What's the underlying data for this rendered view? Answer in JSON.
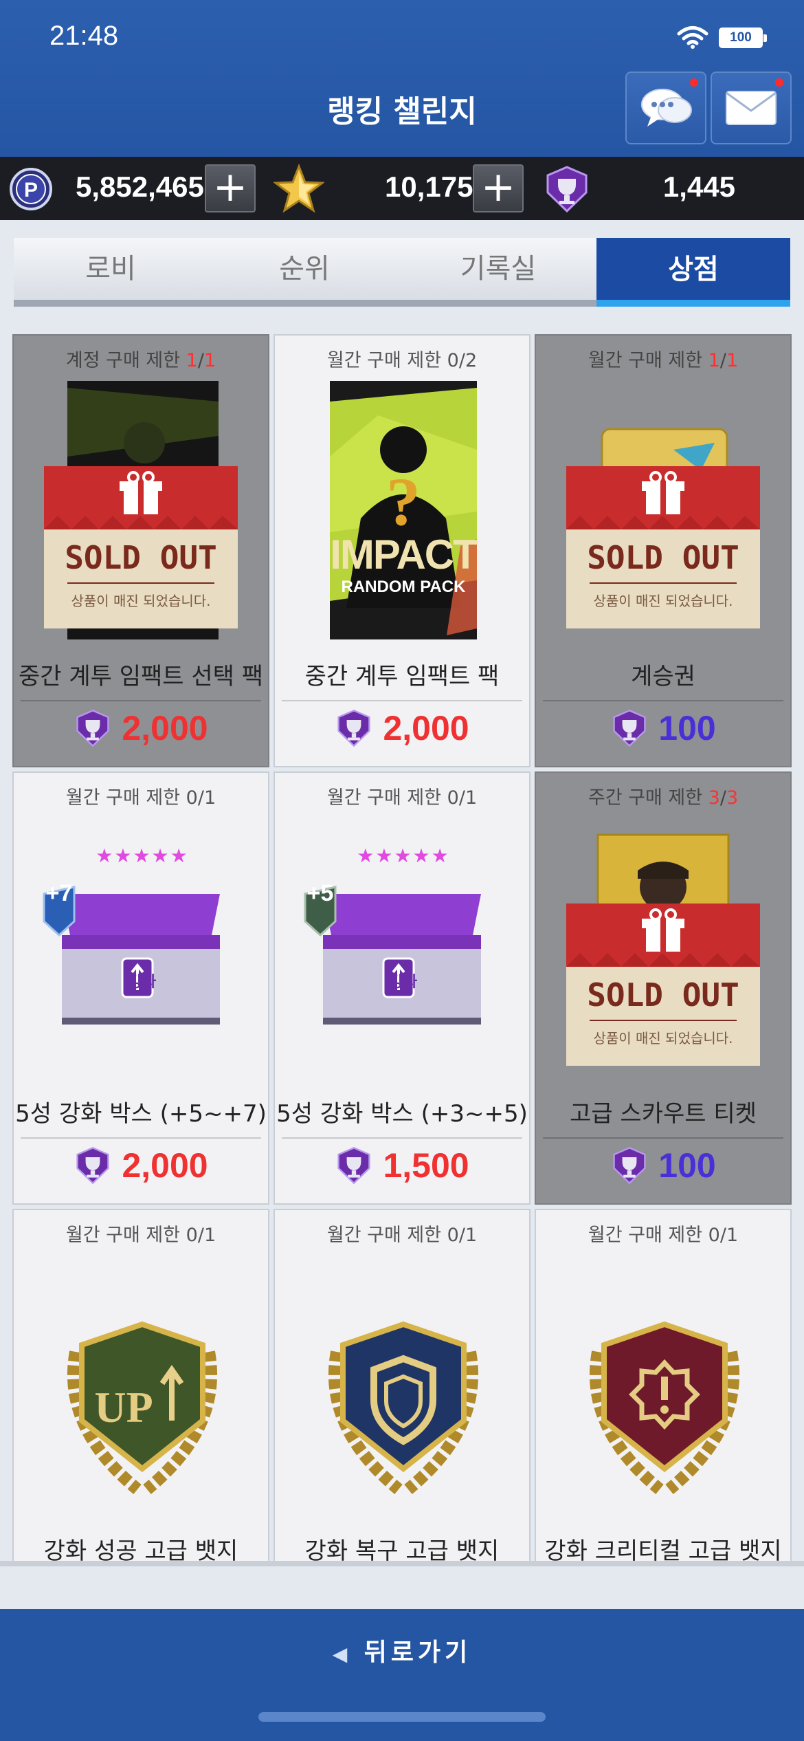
{
  "status_bar": {
    "time": "21:48",
    "battery": "100"
  },
  "header": {
    "title": "랭킹 챌린지",
    "chat_icon": "chat-bubble-icon",
    "mail_icon": "envelope-icon"
  },
  "currency": {
    "points": "5,852,465",
    "stars": "10,175",
    "trophies": "1,445",
    "plus": "+"
  },
  "tabs": [
    {
      "label": "로비",
      "active": false
    },
    {
      "label": "순위",
      "active": false
    },
    {
      "label": "기록실",
      "active": false
    },
    {
      "label": "상점",
      "active": true
    }
  ],
  "items": [
    {
      "limit_prefix": "계정 구매 제한 ",
      "limit_count": "1",
      "limit_sep": "/",
      "limit_total": "1",
      "name": "중간 계투 임팩트 선택 팩",
      "price": "2,000",
      "price_color": "red",
      "sold_out": true
    },
    {
      "limit_prefix": "월간 구매 제한 ",
      "limit_count": "0",
      "limit_sep": "/",
      "limit_total": "2",
      "name": "중간 계투 임팩트 팩",
      "price": "2,000",
      "price_color": "red",
      "sold_out": false
    },
    {
      "limit_prefix": "월간 구매 제한 ",
      "limit_count": "1",
      "limit_sep": "/",
      "limit_total": "1",
      "name": "계승권",
      "price": "100",
      "price_color": "blue",
      "sold_out": true
    },
    {
      "limit_prefix": "월간 구매 제한 ",
      "limit_count": "0",
      "limit_sep": "/",
      "limit_total": "1",
      "name": "5성 강화 박스 (+5~+7)",
      "price": "2,000",
      "price_color": "red",
      "sold_out": false,
      "badge": "+7"
    },
    {
      "limit_prefix": "월간 구매 제한 ",
      "limit_count": "0",
      "limit_sep": "/",
      "limit_total": "1",
      "name": "5성 강화 박스 (+3~+5)",
      "price": "1,500",
      "price_color": "red",
      "sold_out": false,
      "badge": "+5"
    },
    {
      "limit_prefix": "주간 구매 제한 ",
      "limit_count": "3",
      "limit_sep": "/",
      "limit_total": "3",
      "name": "고급 스카우트 티켓",
      "price": "100",
      "price_color": "blue",
      "sold_out": true
    },
    {
      "limit_prefix": "월간 구매 제한 ",
      "limit_count": "0",
      "limit_sep": "/",
      "limit_total": "1",
      "name": "강화 성공 고급 뱃지",
      "sold_out": false
    },
    {
      "limit_prefix": "월간 구매 제한 ",
      "limit_count": "0",
      "limit_sep": "/",
      "limit_total": "1",
      "name": "강화 복구 고급 뱃지",
      "sold_out": false
    },
    {
      "limit_prefix": "월간 구매 제한 ",
      "limit_count": "0",
      "limit_sep": "/",
      "limit_total": "1",
      "name": "강화 크리티컬 고급 뱃지",
      "sold_out": false
    }
  ],
  "sold_out_tag": {
    "title": "SOLD OUT",
    "subtitle": "상품이 매진 되었습니다."
  },
  "pack_art": {
    "question": "?",
    "title": "IMPACT",
    "subtitle": "RANDOM PACK"
  },
  "box_art": {
    "label": "강화",
    "stars": "★★★★★"
  },
  "badge_art": {
    "up": "UP"
  },
  "footer": {
    "back_label": "뒤로가기"
  },
  "colors": {
    "header_blue": "#2456a4",
    "tab_active": "#1b4ba3",
    "price_red": "#ef3131",
    "price_blue": "#4a2fd7",
    "limit_red": "#ff3030"
  }
}
